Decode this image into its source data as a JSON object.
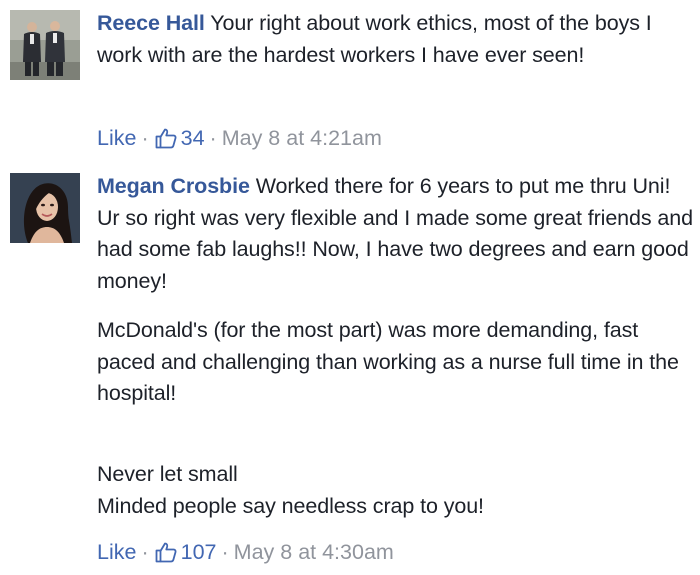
{
  "comments": [
    {
      "author": "Reece Hall",
      "lines": [
        "Your right about work ethics, most of the boys I work with are the hardest workers I have ever seen!"
      ],
      "paragraphs": [
        "Your right about work ethics, most of the boys I work with are the hardest workers I have ever seen!"
      ],
      "like_label": "Like",
      "separator": "·",
      "like_count": "34",
      "timestamp": "May 8 at 4:21am",
      "avatar_icon": "profile-photo-two-men-in-suits"
    },
    {
      "author": "Megan Crosbie",
      "paragraphs": [
        "Worked there for 6 years to put me thru Uni! Ur so right was very flexible and I made some great friends and had some fab laughs!! Now, I have two degrees and earn good money!",
        "McDonald's (for the most part) was more demanding, fast paced and challenging than working as a nurse full time in the hospital!",
        "Never let small\nMinded people say needless crap to you!"
      ],
      "like_label": "Like",
      "separator": "·",
      "like_count": "107",
      "timestamp": "May 8 at 4:30am",
      "avatar_icon": "profile-photo-woman-long-dark-hair"
    }
  ],
  "colors": {
    "author_link": "#365899",
    "action_link": "#4267b2",
    "meta_gray": "#90949c",
    "body_text": "#1d2129"
  }
}
